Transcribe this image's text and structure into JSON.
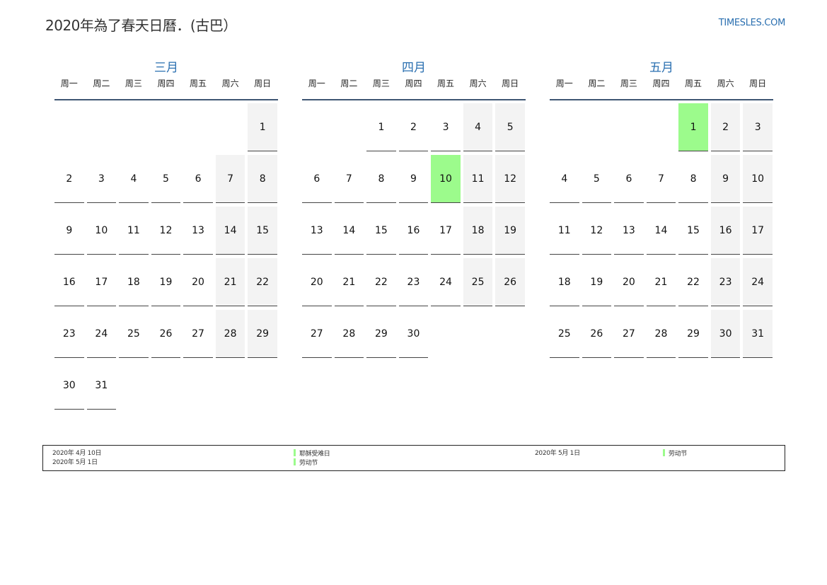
{
  "header": {
    "title": "2020年為了春天日曆．(古巴）",
    "site": "TIMESLES.COM"
  },
  "weekdays": [
    "周一",
    "周二",
    "周三",
    "周四",
    "周五",
    "周六",
    "周日"
  ],
  "colors": {
    "accent": "#2a6fb0",
    "weekend_bg": "#f3f3f3",
    "holiday_bg": "#9cfb8c",
    "divider": "#3e5573"
  },
  "months": [
    {
      "name": "三月",
      "offset": 6,
      "days": 31,
      "holidays": []
    },
    {
      "name": "四月",
      "offset": 2,
      "days": 30,
      "holidays": [
        10
      ]
    },
    {
      "name": "五月",
      "offset": 4,
      "days": 31,
      "holidays": [
        1
      ]
    }
  ],
  "legend": [
    {
      "date": "2020年 4月 10日",
      "name": "耶稣受难日"
    },
    {
      "date": "2020年 5月 1日",
      "name": "劳动节"
    },
    {
      "date": "2020年 5月 1日",
      "name": "劳动节"
    }
  ]
}
